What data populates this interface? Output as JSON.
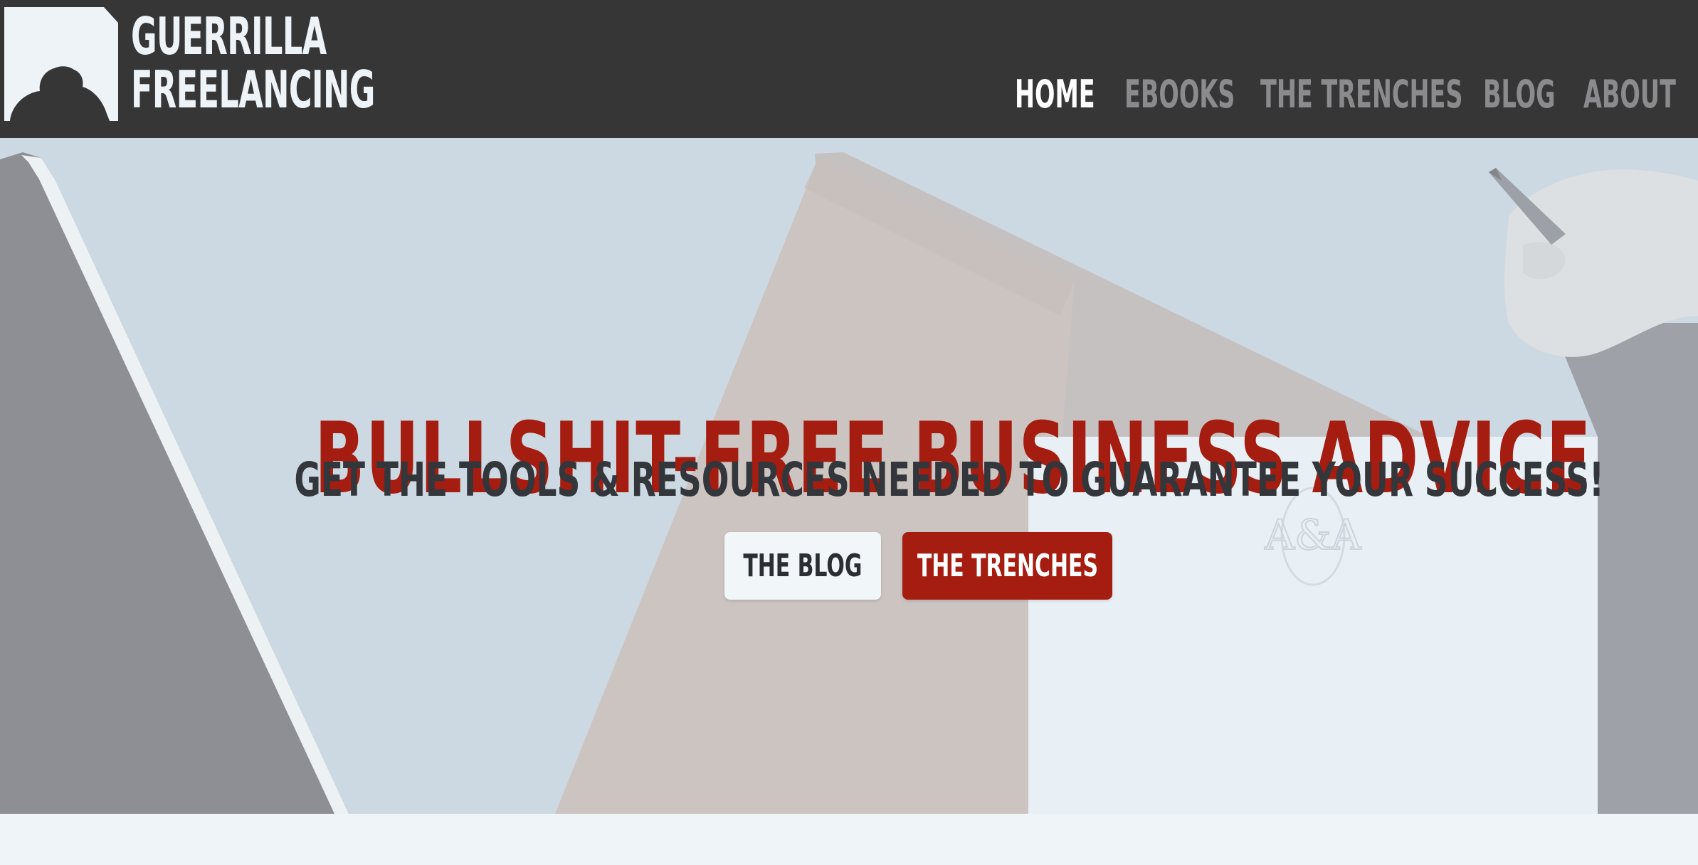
{
  "header": {
    "logo": {
      "line1": "GUERRILLA",
      "line2": "FREELANCING"
    },
    "nav": {
      "home": "HOME",
      "ebooks": "EBOOKS",
      "trenches": "THE TRENCHES",
      "blog": "BLOG",
      "about": "ABOUT",
      "active": "HOME"
    }
  },
  "hero": {
    "title": "BULLSHIT-FREE BUSINESS ADVICE",
    "subtitle": "GET THE TOOLS & RESOURCES NEEDED TO GUARANTEE YOUR SUCCESS!",
    "button_blog": "THE BLOG",
    "button_trenches": "THE TRENCHES",
    "stamp_text": "A&A"
  },
  "colors": {
    "header_bg": "#363637",
    "accent_red": "#a51d10",
    "nav_active": "#ffffff",
    "nav_inactive": "#8b8b8d",
    "page_bg": "#eef4f8"
  },
  "icons": {
    "logo_mark": "guerrilla-gorilla-silhouette-icon"
  }
}
